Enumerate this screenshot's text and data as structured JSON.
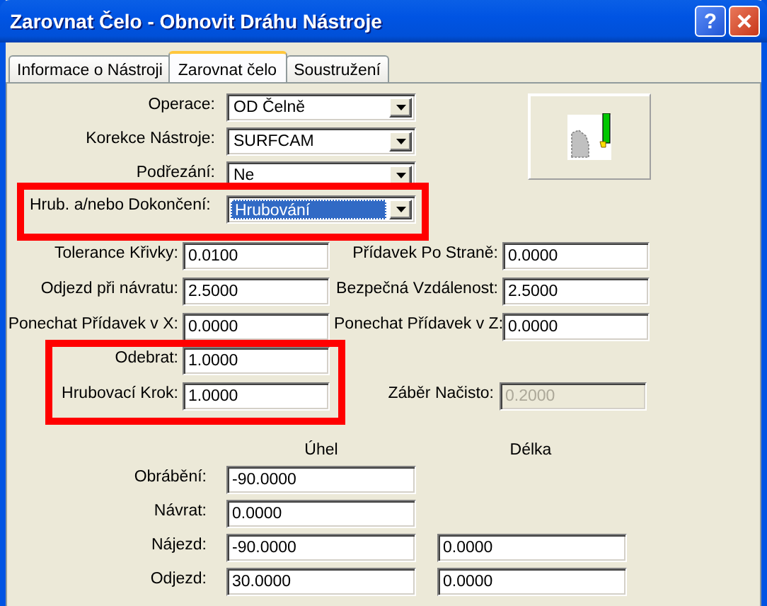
{
  "window": {
    "title": "Zarovnat Čelo - Obnovit Dráhu Nástroje",
    "help_label": "?"
  },
  "tabs": [
    {
      "label": "Informace o Nástroji",
      "selected": false
    },
    {
      "label": "Zarovnat čelo",
      "selected": true
    },
    {
      "label": "Soustružení",
      "selected": false
    }
  ],
  "dropdowns": [
    {
      "label": "Operace:",
      "value": "OD Čelně",
      "focused": false,
      "highlighted": false
    },
    {
      "label": "Korekce Nástroje:",
      "value": "SURFCAM",
      "focused": false,
      "highlighted": false
    },
    {
      "label": "Podřezání:",
      "value": "Ne",
      "focused": false,
      "highlighted": false
    },
    {
      "label": "Hrub. a/nebo Dokončení:",
      "value": "Hrubování",
      "focused": true,
      "highlighted": true
    }
  ],
  "field_rows": [
    [
      {
        "label": "Tolerance Křivky:",
        "value": "0.0100"
      },
      {
        "label": "Přídavek Po Straně:",
        "value": "0.0000"
      }
    ],
    [
      {
        "label": "Odjezd při návratu:",
        "value": "2.5000"
      },
      {
        "label": "Bezpečná Vzdálenost:",
        "value": "2.5000"
      }
    ],
    [
      {
        "label": "Ponechat Přídavek v X:",
        "value": "0.0000"
      },
      {
        "label": "Ponechat Přídavek v Z:",
        "value": "0.0000"
      }
    ]
  ],
  "roughing": {
    "highlighted": true,
    "fields": [
      {
        "label": "Odebrat:",
        "value": "1.0000"
      },
      {
        "label": "Hrubovací Krok:",
        "value": "1.0000"
      }
    ]
  },
  "finish_cut": {
    "label": "Záběr Načisto:",
    "value": "0.2000",
    "disabled": true
  },
  "motion": {
    "columns": [
      "Úhel",
      "Délka"
    ],
    "rows": [
      {
        "label": "Obrábění:",
        "angle": "-90.0000"
      },
      {
        "label": "Návrat:",
        "angle": "0.0000"
      },
      {
        "label": "Nájezd:",
        "angle": "-90.0000",
        "length": "0.0000"
      },
      {
        "label": "Odjezd:",
        "angle": "30.0000",
        "length": "0.0000"
      }
    ]
  }
}
